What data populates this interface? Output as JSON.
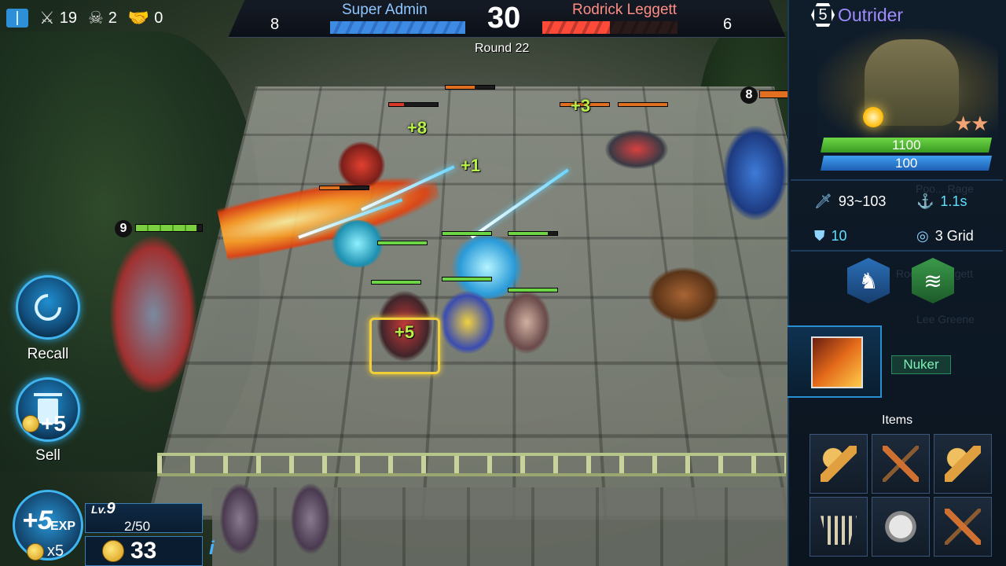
{
  "hud": {
    "kills": "19",
    "deaths": "2",
    "assists": "0"
  },
  "scoreboard": {
    "left_player": "Super Admin",
    "left_count": "8",
    "right_player": "Rodrick Leggett",
    "right_count": "6",
    "timer": "30",
    "round": "Round 22",
    "left_health_fraction": 1.0,
    "right_health_fraction": 0.5
  },
  "controls": {
    "recall_label": "Recall",
    "sell_label": "Sell",
    "sell_value": "+5",
    "exp_value": "+5",
    "exp_unit": "EXP",
    "exp_cost_multiplier": "x5",
    "level_prefix": "Lv.",
    "level": "9",
    "xp": "2/50",
    "gold": "33",
    "info_icon": "i"
  },
  "battlefield": {
    "player_level_left": "9",
    "enemy_level_right": "8",
    "floating_numbers": [
      "+8",
      "+1",
      "+3",
      "+5"
    ]
  },
  "hero": {
    "cost": "5",
    "name": "Outrider",
    "stars": 2,
    "hp": "1100",
    "mana": "100",
    "attack": "93~103",
    "attack_speed": "1.1s",
    "armor": "10",
    "range": "3 Grid",
    "role": "Nuker",
    "items_title": "Items",
    "traits": [
      "horse-knight-icon",
      "claw-strike-icon"
    ],
    "items": [
      "golden-axe-icon",
      "crossbow-icon",
      "golden-axe-icon",
      "bone-necklace-icon",
      "spiked-armor-icon",
      "crossbow-icon"
    ]
  },
  "colors": {
    "accent_blue": "#3fb5f0",
    "hp_green": "#6cd645",
    "mana_blue": "#3f9ef0",
    "enemy_red": "#ff4a3a",
    "hero_name": "#9f8cff"
  }
}
